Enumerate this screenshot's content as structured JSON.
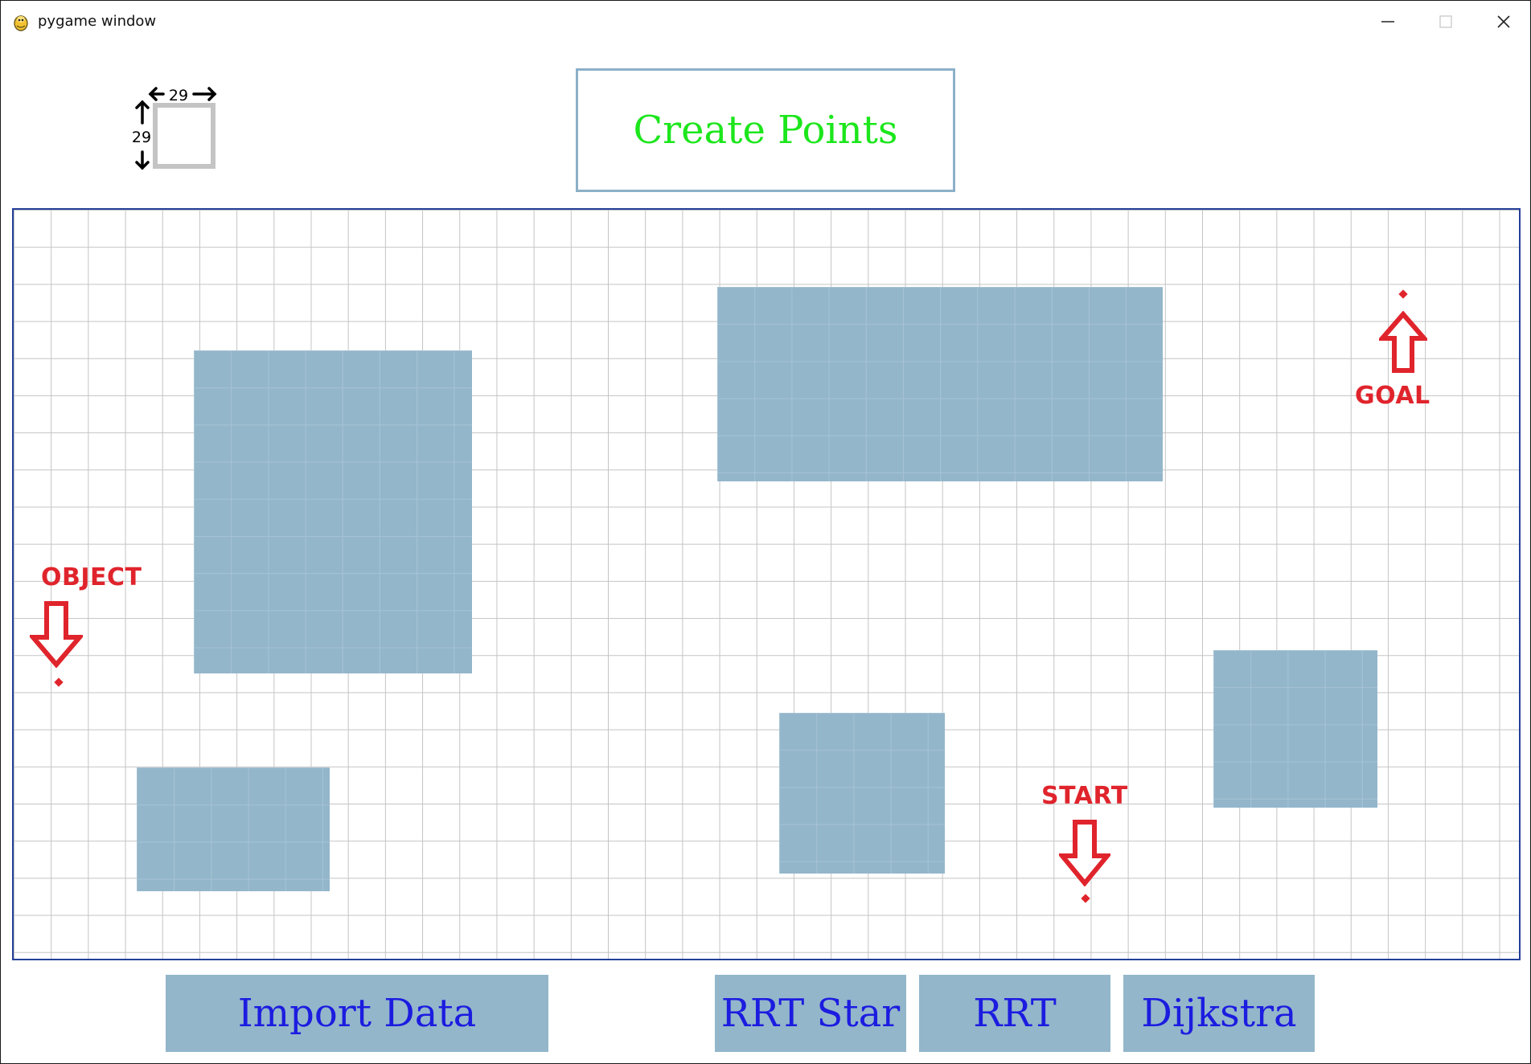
{
  "window": {
    "title": "pygame window",
    "controls": {
      "minimize": "—",
      "maximize": "□",
      "close": "✕"
    }
  },
  "grid_size_widget": {
    "width_label": "29",
    "height_label": "29"
  },
  "header": {
    "create_points_label": "Create Points"
  },
  "markers": {
    "goal": {
      "label": "GOAL"
    },
    "object": {
      "label": "OBJECT"
    },
    "start": {
      "label": "START"
    }
  },
  "buttons": {
    "import_data": "Import Data",
    "rrt_star": "RRT Star",
    "rrt": "RRT",
    "dijkstra": "Dijkstra"
  },
  "colors": {
    "create_points_text": "#1ce61c",
    "button_text": "#1c1ce0",
    "button_fill": "#93b6cb",
    "obstacle_fill": "#93b6cb",
    "marker": "#e0242c",
    "workspace_border": "#25409a",
    "grid_line": "#c4c4c4"
  }
}
